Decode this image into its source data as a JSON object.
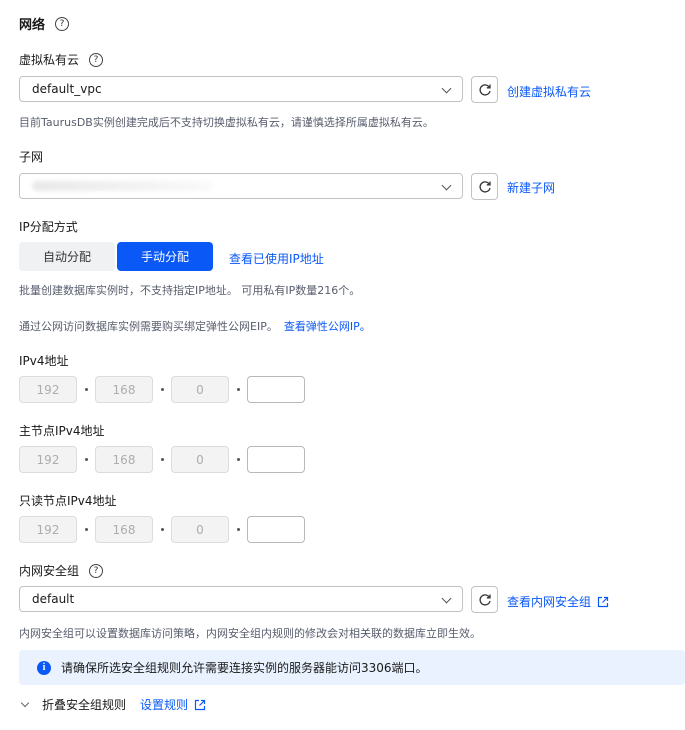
{
  "network": {
    "title": "网络"
  },
  "vpc": {
    "label": "虚拟私有云",
    "value": "default_vpc",
    "create_link": "创建虚拟私有云",
    "hint": "目前TaurusDB实例创建完成后不支持切换虚拟私有云，请谨慎选择所属虚拟私有云。"
  },
  "subnet": {
    "label": "子网",
    "create_link": "新建子网"
  },
  "ip_assign": {
    "label": "IP分配方式",
    "options": [
      "自动分配",
      "手动分配"
    ],
    "selected": "手动分配",
    "view_link": "查看已使用IP地址",
    "hint": "批量创建数据库实例时，不支持指定IP地址。 可用私有IP数量216个。"
  },
  "eip": {
    "hint": "通过公网访问数据库实例需要购买绑定弹性公网EIP。",
    "link": "查看弹性公网IP。"
  },
  "ipv4": {
    "label": "IPv4地址",
    "octets": [
      "192",
      "168",
      "0",
      ""
    ]
  },
  "primary_ipv4": {
    "label": "主节点IPv4地址",
    "octets": [
      "192",
      "168",
      "0",
      ""
    ]
  },
  "readonly_ipv4": {
    "label": "只读节点IPv4地址",
    "octets": [
      "192",
      "168",
      "0",
      ""
    ]
  },
  "security_group": {
    "label": "内网安全组",
    "value": "default",
    "view_link": "查看内网安全组",
    "hint": "内网安全组可以设置数据库访问策略，内网安全组内规则的修改会对相关联的数据库立即生效。",
    "notice": "请确保所选安全组规则允许需要连接实例的服务器能访问3306端口。",
    "collapse_label": "折叠安全组规则",
    "rules_link": "设置规则"
  },
  "icons": {
    "help": "question-circle-icon",
    "refresh": "refresh-icon",
    "chevron": "chevron-down-icon",
    "external": "external-link-icon",
    "info": "info-icon"
  },
  "colors": {
    "accent": "#0a59f7",
    "notice_bg": "#e9f2fe"
  }
}
